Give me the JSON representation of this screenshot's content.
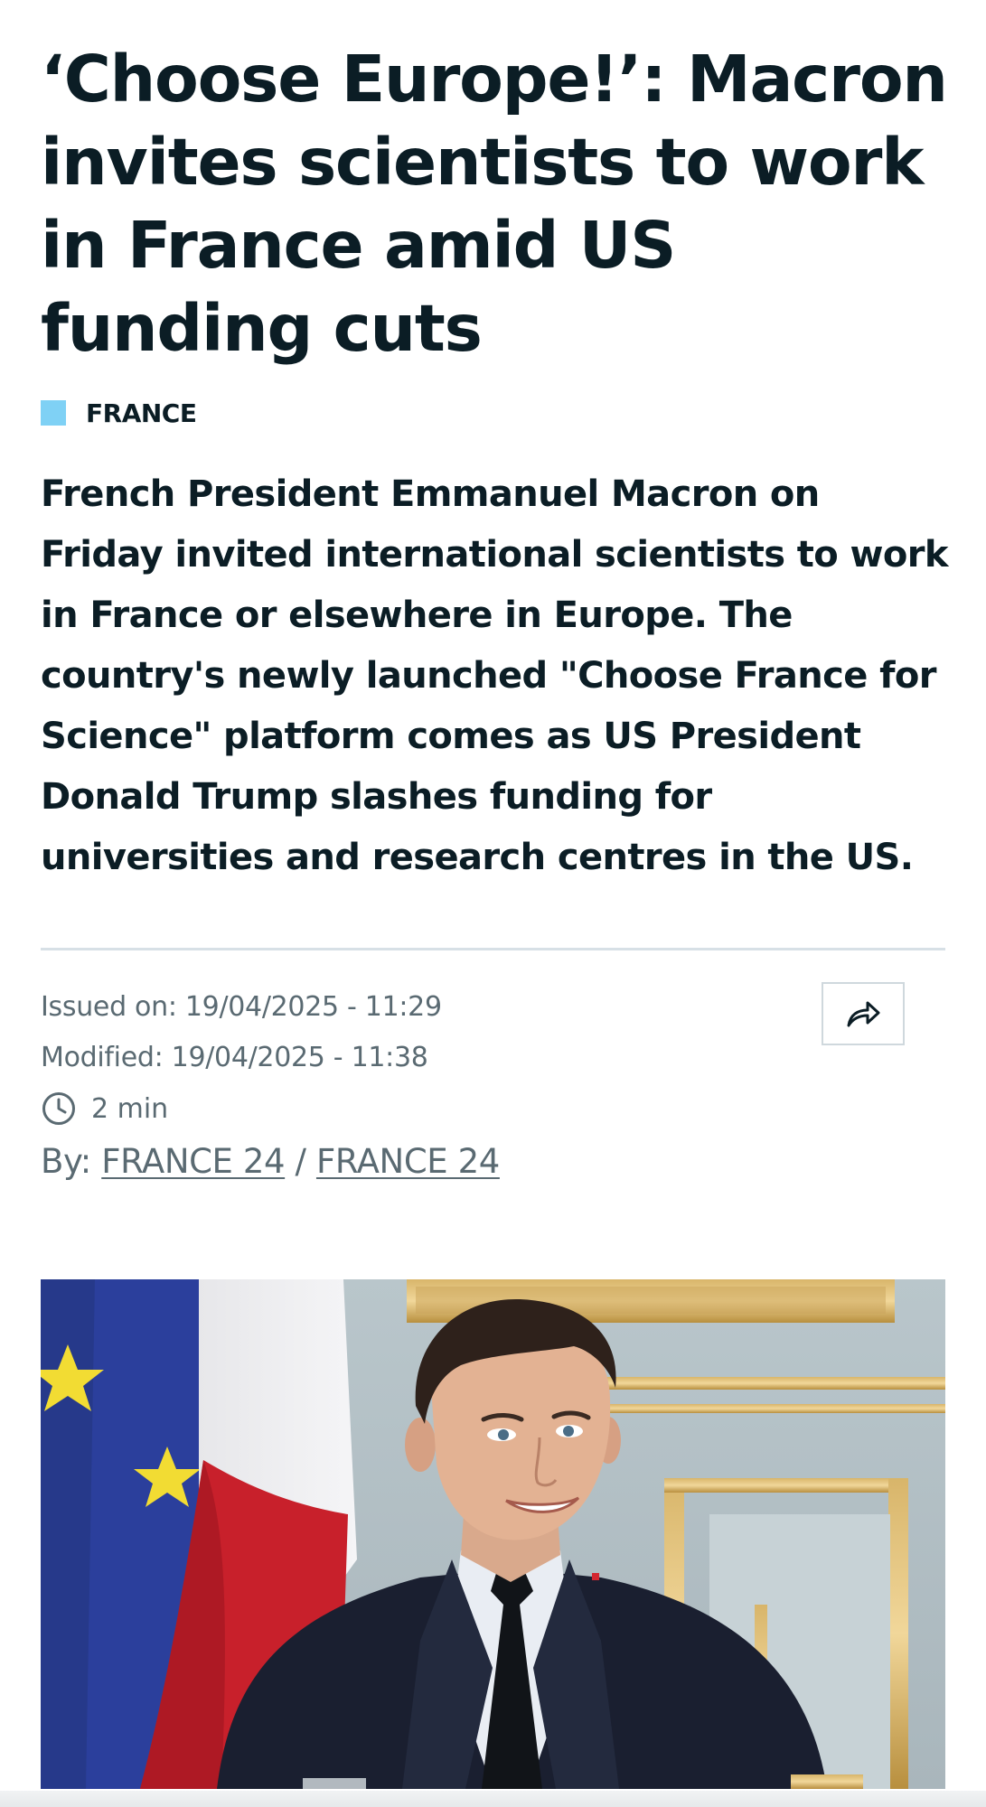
{
  "article": {
    "title": "‘Choose Europe!’: Macron invites scientists to work in France amid US funding cuts",
    "section": {
      "label": "FRANCE",
      "color": "#7fd1f5"
    },
    "lead": "French President Emmanuel Macron on Friday invited international scientists to work in France or elsewhere in Europe. The country's newly launched \"Choose France for Science\" platform comes as US President Donald Trump slashes funding for universities and research centres in the US.",
    "meta": {
      "issued": "Issued on: 19/04/2025 - 11:29",
      "modified": "Modified: 19/04/2025 - 11:38",
      "read_time": "2 min",
      "by_prefix": "By: ",
      "authors": [
        "FRANCE 24",
        "FRANCE 24"
      ],
      "author_separator": " / "
    },
    "share_icon": "share-arrow-icon",
    "photo": {
      "icon": "photo-macron-with-flags"
    }
  },
  "colors": {
    "text": "#0b1d25",
    "meta_text": "#5a6a72",
    "divider": "#d7e0e6",
    "accent": "#7fd1f5"
  }
}
